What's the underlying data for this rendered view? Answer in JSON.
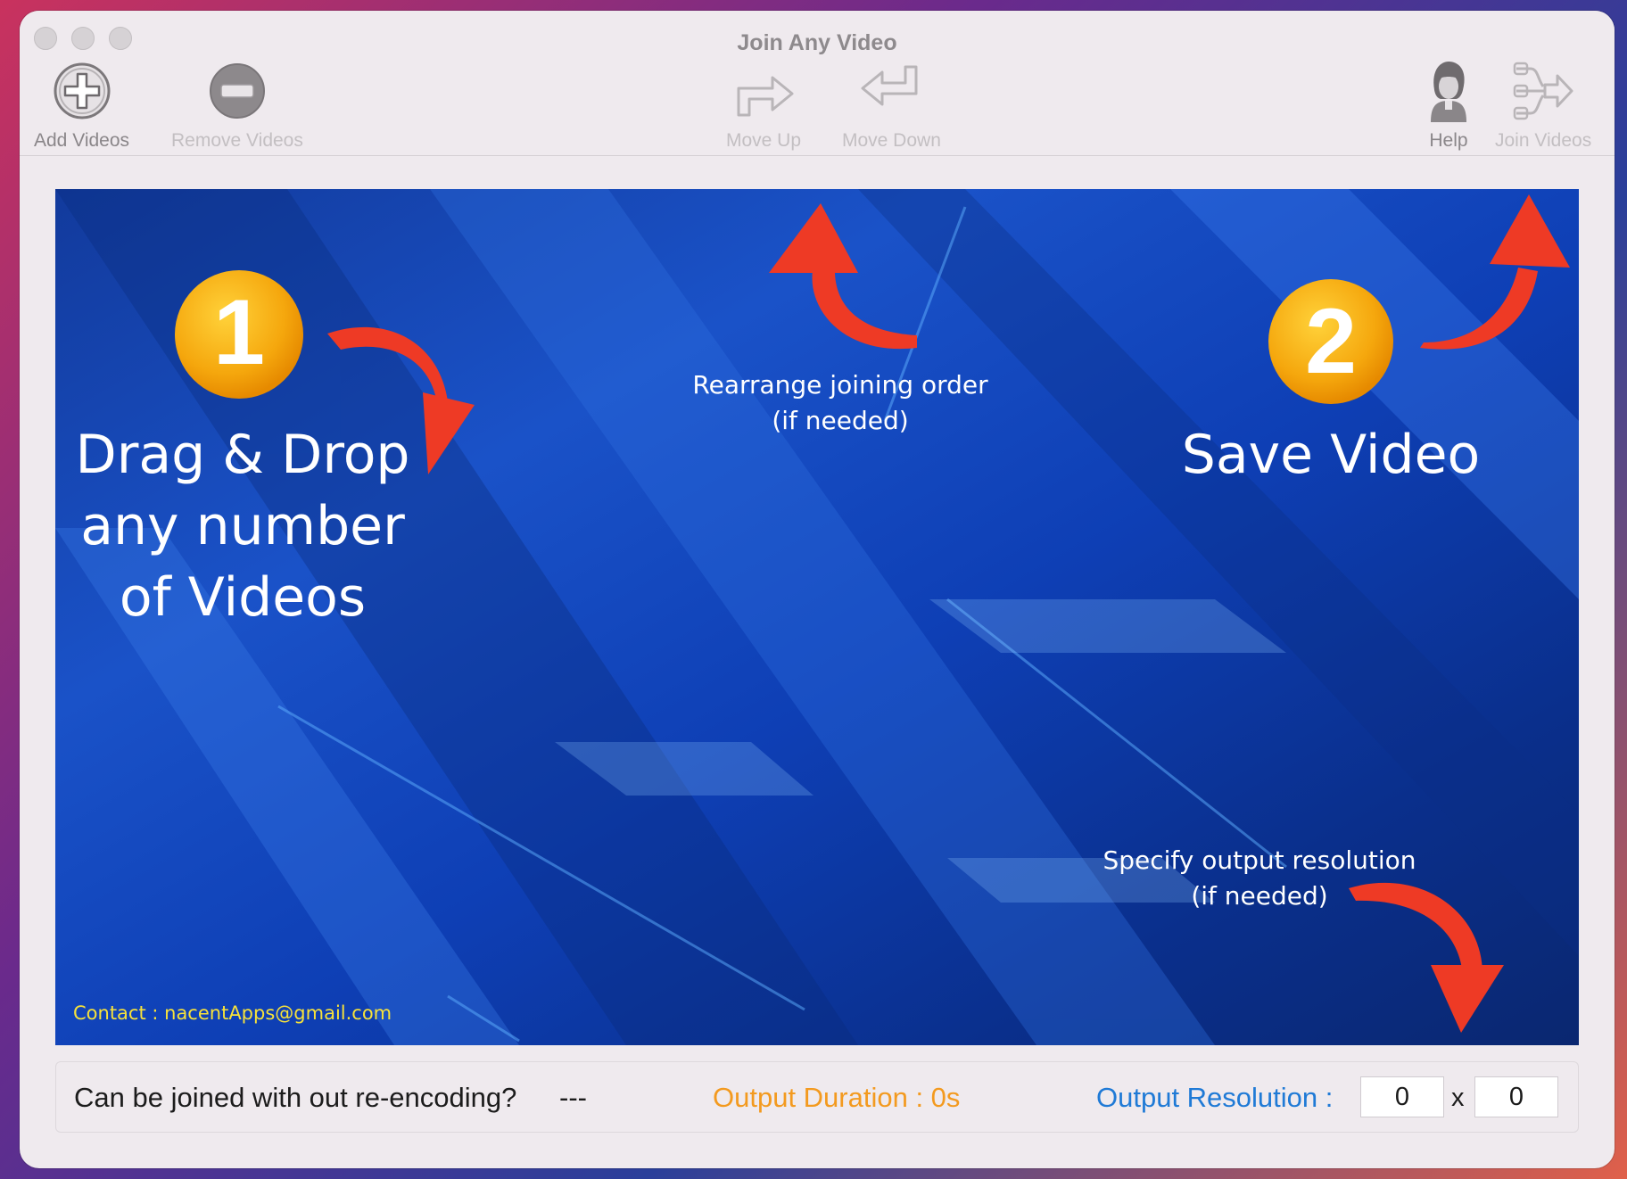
{
  "window": {
    "title": "Join Any Video"
  },
  "toolbar": {
    "add_videos": "Add Videos",
    "remove_videos": "Remove Videos",
    "move_up": "Move Up",
    "move_down": "Move Down",
    "help": "Help",
    "join_videos": "Join Videos"
  },
  "banner": {
    "step1_number": "1",
    "step1_line1": "Drag & Drop",
    "step1_line2": "any number",
    "step1_line3": "of Videos",
    "rearrange_line1": "Rearrange joining order",
    "rearrange_line2": "(if needed)",
    "step2_number": "2",
    "step2_text": "Save Video",
    "resolution_line1": "Specify output resolution",
    "resolution_line2": "(if needed)",
    "contact": "Contact : nacentApps@gmail.com"
  },
  "status": {
    "reencode_label": "Can be joined with out re-encoding?",
    "reencode_value": "---",
    "duration": "Output Duration : 0s",
    "resolution_label": "Output Resolution :",
    "width": "0",
    "separator": "x",
    "height": "0"
  },
  "colors": {
    "duration": "#f39a1f",
    "resolution_label": "#1f7ad6",
    "arrow": "#ee3a25",
    "badge": "#f5a70d",
    "contact": "#f7e23a"
  }
}
